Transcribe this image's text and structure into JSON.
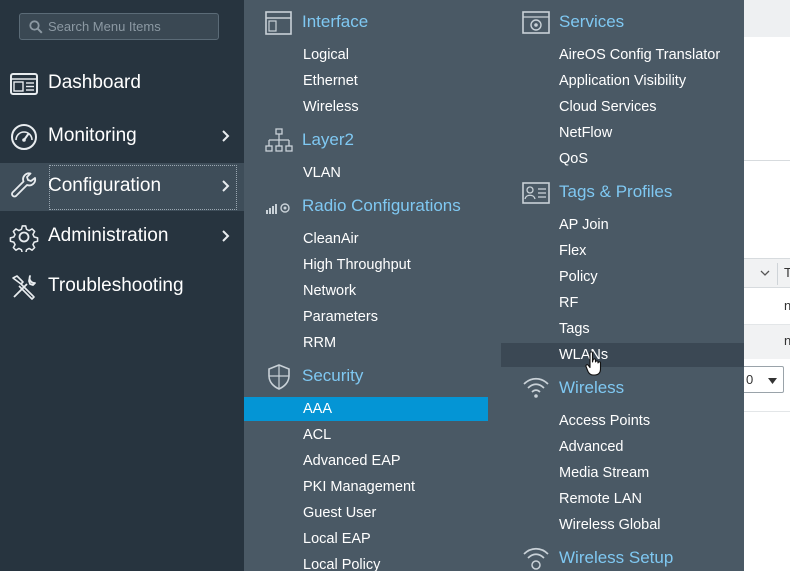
{
  "search": {
    "placeholder": "Search Menu Items"
  },
  "sidebar": {
    "items": [
      {
        "label": "Dashboard",
        "icon": "dashboard-icon"
      },
      {
        "label": "Monitoring",
        "icon": "gauge-icon"
      },
      {
        "label": "Configuration",
        "icon": "wrench-icon"
      },
      {
        "label": "Administration",
        "icon": "gear-icon"
      },
      {
        "label": "Troubleshooting",
        "icon": "tools-icon"
      }
    ]
  },
  "menu": {
    "interface": {
      "title": "Interface",
      "items": [
        "Logical",
        "Ethernet",
        "Wireless"
      ]
    },
    "layer2": {
      "title": "Layer2",
      "items": [
        "VLAN"
      ]
    },
    "radio": {
      "title": "Radio Configurations",
      "items": [
        "CleanAir",
        "High Throughput",
        "Network",
        "Parameters",
        "RRM"
      ]
    },
    "security": {
      "title": "Security",
      "items": [
        "AAA",
        "ACL",
        "Advanced EAP",
        "PKI Management",
        "Guest User",
        "Local EAP",
        "Local Policy"
      ]
    },
    "services": {
      "title": "Services",
      "items": [
        "AireOS Config Translator",
        "Application Visibility",
        "Cloud Services",
        "NetFlow",
        "QoS"
      ]
    },
    "tags": {
      "title": "Tags & Profiles",
      "items": [
        "AP Join",
        "Flex",
        "Policy",
        "RF",
        "Tags",
        "WLANs"
      ]
    },
    "wireless": {
      "title": "Wireless",
      "items": [
        "Access Points",
        "Advanced",
        "Media Stream",
        "Remote LAN",
        "Wireless Global"
      ]
    },
    "wireless_setup": {
      "title": "Wireless Setup"
    }
  },
  "background": {
    "col_header_fragment": "T",
    "row1_fragment": "n",
    "row2_fragment": "n",
    "select_value": "0"
  },
  "colors": {
    "sidebar": "#27343f",
    "panel": "#4a5965",
    "accent_title": "#7fc8f2",
    "selected": "#0495d5"
  }
}
